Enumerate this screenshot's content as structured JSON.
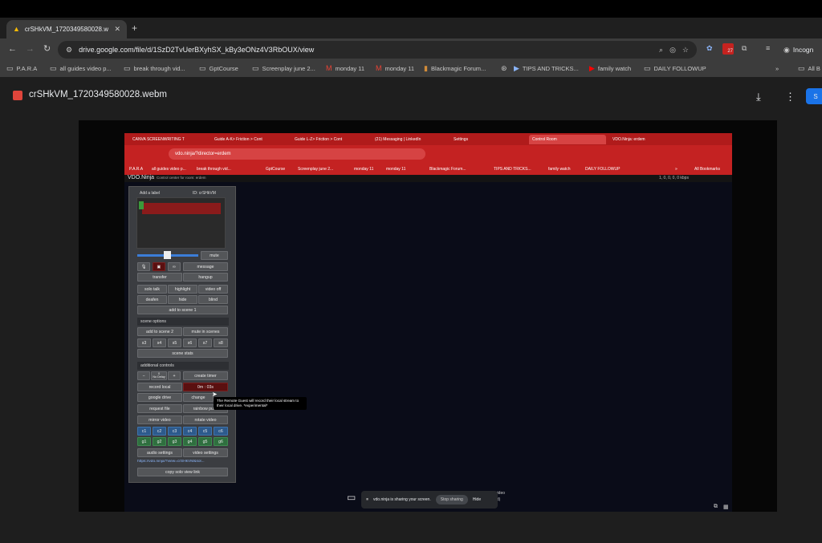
{
  "browser": {
    "tab_title": "crSHkVM_1720349580028.w",
    "url": "drive.google.com/file/d/1SzD2TvUerBXyhSX_kBy3eONz4V3RbOUX/view",
    "profile_label": "Incogn",
    "badge_count": "27",
    "bookmarks": [
      "P.A.R.A",
      "all guides video p...",
      "break through vid...",
      "GptCourse",
      "Screenplay june 2...",
      "monday 11",
      "monday 11",
      "Blackmagic Forum...",
      "TIPS AND TRICKS...",
      "family watch",
      "DAILY FOLLOWUP",
      "All B"
    ],
    "more_bookmarks": "»"
  },
  "drive": {
    "file_name": "crSHkVM_1720349580028.webm",
    "share_label": "S"
  },
  "recording": {
    "tabs": [
      "CANVA SCREENWRITING T",
      "Guide A-K> Friction > Cont",
      "Guide L-Z> Friction > Cont",
      "(21) Messaging | LinkedIn",
      "Settings",
      "Control Room",
      "VDO.Ninja: erdem"
    ],
    "url": "vdo.ninja/?director=erdem",
    "bookmarks": [
      "P.A.R.A",
      "all guides video p...",
      "break through vid...",
      "GptCourse",
      "Screenplay june 2...",
      "monday 11",
      "monday 11",
      "Blackmagic Forum...",
      "TIPS AND TRICKS...",
      "family watch",
      "DAILY FOLLOWUP",
      "»",
      "All Bookmarks"
    ],
    "app_title": "VDO.Ninja",
    "app_subtitle": "Control center for room: erdem",
    "stats": "1, 0, 0, 0, 0 kbps",
    "panel": {
      "add_label": "Add a label",
      "id_label": "ID: crSHkVM",
      "mute": "mute",
      "message": "message",
      "transfer": "transfer",
      "hangup": "hangup",
      "solo_talk": "solo talk",
      "highlight": "highlight",
      "video_off": "video off",
      "deafen": "deafen",
      "hide": "hide",
      "blind": "blind",
      "add_scene1": "add to scene 1",
      "scene_options": "scene options",
      "add_scene2": "add to scene 2",
      "mute_scenes": "mute in scenes",
      "scenes": [
        "s3",
        "s4",
        "s5",
        "s6",
        "s7",
        "s8"
      ],
      "scene_stats": "scene stats",
      "additional_controls": "additional controls",
      "minus": "−",
      "delay_value": "0",
      "delay_label": "No Delay",
      "plus": "+",
      "create_timer": "create timer",
      "record_local": "record local",
      "record_time": "0m : 03s",
      "google_drive": "google drive",
      "change": "change",
      "request_file": "request file",
      "rainbow": "rainbow puke",
      "mirror_video": "mirror video",
      "rotate_video": "rotate video",
      "c_buttons": [
        "c1",
        "c2",
        "c3",
        "c4",
        "c5",
        "c6"
      ],
      "g_buttons": [
        "g1",
        "g2",
        "g3",
        "g4",
        "g5",
        "g6"
      ],
      "audio_settings": "audio settings",
      "video_settings": "video settings",
      "view_link": "https://vdo.ninja/?view=crSHkVM&sol...",
      "copy_link": "copy solo view link"
    },
    "tooltip": "The Remote Guest will record their local stream to their local drive. *experimental*",
    "share_bar": {
      "text": "vdo.ninja is sharing your screen.",
      "stop": "Stop sharing",
      "hide": "Hide",
      "behind_text": "r video",
      "behind_text2": "ed)"
    }
  },
  "colors": {
    "accent": "#1a73e8",
    "recording_chrome": "#c42222",
    "record_red": "#e0453b"
  }
}
